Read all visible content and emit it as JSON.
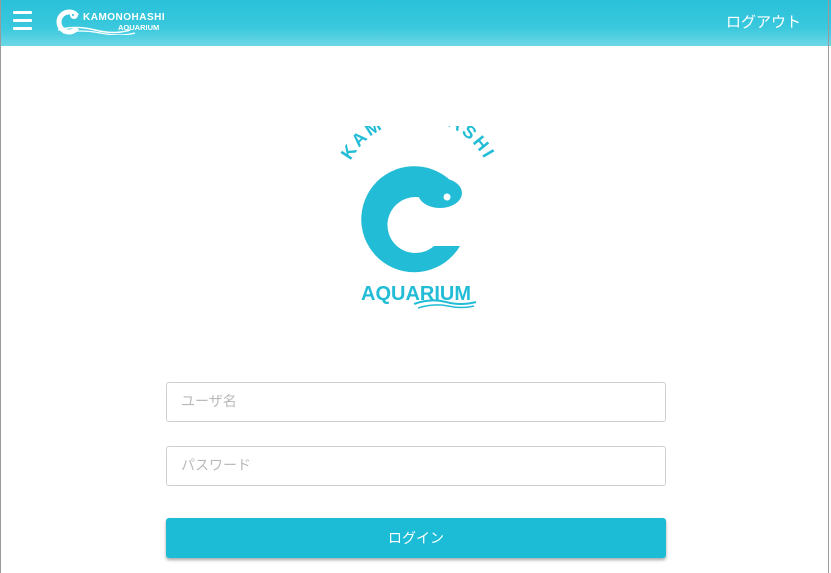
{
  "header": {
    "menu_icon": "hamburger-icon",
    "logo": {
      "line1": "KAMONOHASHI",
      "line2": "AQUARIUM"
    },
    "logout_label": "ログアウト"
  },
  "main_logo": {
    "arc_text": "KAMONOHASHI",
    "bottom_text": "AQUARIUM"
  },
  "login_form": {
    "username_placeholder": "ユーザ名",
    "password_placeholder": "パスワード",
    "login_button_label": "ログイン"
  },
  "colors": {
    "header": "#29c1da",
    "accent": "#1cbcd7",
    "logo": "#23bcd6"
  }
}
